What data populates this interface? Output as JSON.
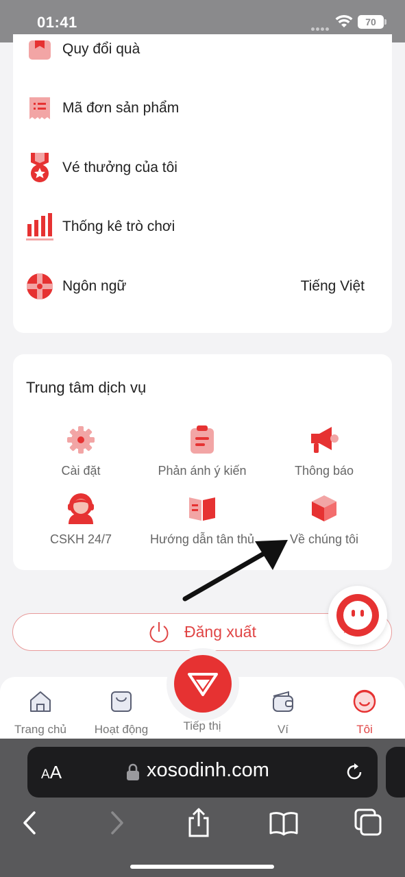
{
  "status_bar": {
    "time": "01:41",
    "battery": "70"
  },
  "menu": {
    "items": [
      {
        "label": "Quy đổi quà",
        "icon": "gift-icon"
      },
      {
        "label": "Mã đơn sản phẩm",
        "icon": "receipt-icon"
      },
      {
        "label": "Vé thưởng của tôi",
        "icon": "medal-icon"
      },
      {
        "label": "Thống kê trò chơi",
        "icon": "bar-chart-icon"
      },
      {
        "label": "Ngôn ngữ",
        "icon": "globe-icon",
        "value": "Tiếng Việt"
      }
    ]
  },
  "service_center": {
    "title": "Trung tâm dịch vụ",
    "items": [
      {
        "label": "Cài đặt",
        "icon": "gear-icon"
      },
      {
        "label": "Phản ánh ý kiến",
        "icon": "clipboard-icon"
      },
      {
        "label": "Thông báo",
        "icon": "megaphone-icon"
      },
      {
        "label": "CSKH 24/7",
        "icon": "support-agent-icon"
      },
      {
        "label": "Hướng dẫn tân thủ",
        "icon": "book-icon"
      },
      {
        "label": "Về chúng tôi",
        "icon": "box-icon"
      }
    ]
  },
  "logout": {
    "label": "Đăng xuất"
  },
  "tabbar": {
    "tabs": [
      {
        "label": "Trang chủ",
        "icon": "home-icon"
      },
      {
        "label": "Hoạt động",
        "icon": "activity-icon"
      },
      {
        "label": "Tiếp thị",
        "icon": "diamond-icon"
      },
      {
        "label": "Ví",
        "icon": "wallet-icon"
      },
      {
        "label": "Tôi",
        "icon": "profile-icon",
        "active": true
      }
    ]
  },
  "browser": {
    "aa": "AA",
    "url": "xosodinh.com"
  },
  "colors": {
    "accent": "#e63232",
    "icon_light": "#f2a5a5",
    "status_bg": "#8a8a8c",
    "browser_bg": "#59595b"
  }
}
